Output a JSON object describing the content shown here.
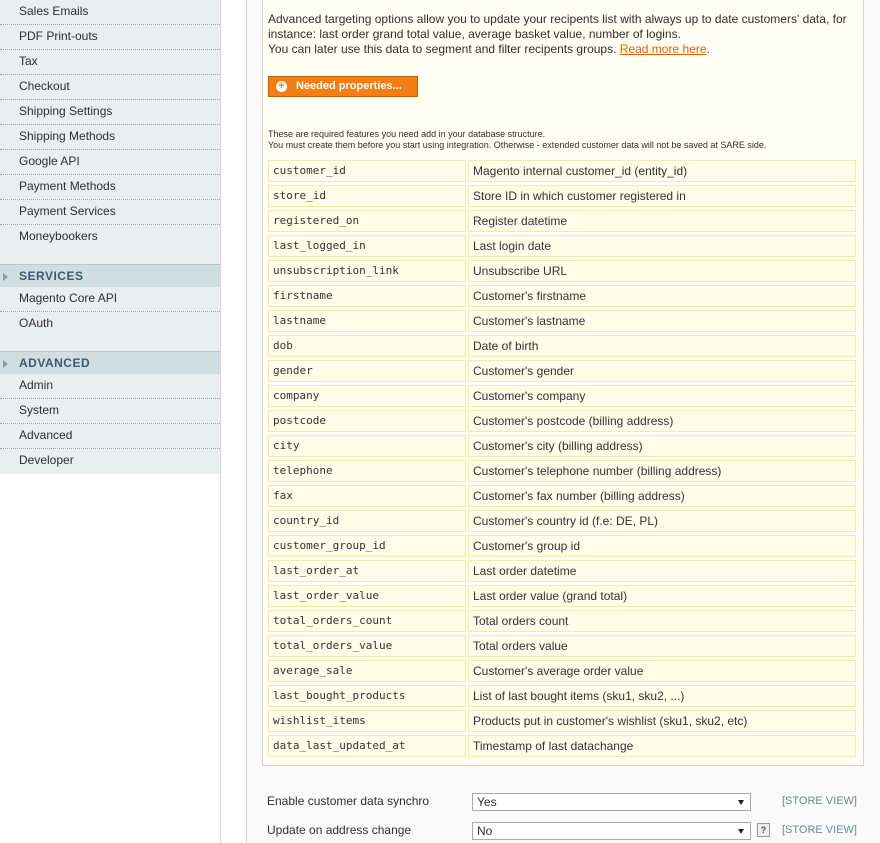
{
  "sidebar": {
    "items_top": [
      "Sales Emails",
      "PDF Print-outs",
      "Tax",
      "Checkout",
      "Shipping Settings",
      "Shipping Methods",
      "Google API",
      "Payment Methods",
      "Payment Services",
      "Moneybookers"
    ],
    "services_header": "SERVICES",
    "services_items": [
      "Magento Core API",
      "OAuth"
    ],
    "advanced_header": "ADVANCED",
    "advanced_items": [
      "Admin",
      "System",
      "Advanced",
      "Developer"
    ]
  },
  "info": {
    "intro_text": "Advanced targeting options allow you to update your recipents list with always up to date customers' data, for instance: last order grand total value, average basket value, number of logins.",
    "intro_text2": "You can later use this data to segment and filter recipents groups.",
    "read_more": "Read more here",
    "needed_button": "Needed properties...",
    "note_line1": "These are required features you need add in your database structure.",
    "note_line2": "You must create them before you start using integration. Otherwise - extended customer data will not be saved at SARE side.",
    "properties": [
      {
        "code": "customer_id",
        "desc": "Magento internal customer_id (entity_id)"
      },
      {
        "code": "store_id",
        "desc": "Store ID in which customer registered in"
      },
      {
        "code": "registered_on",
        "desc": "Register datetime"
      },
      {
        "code": "last_logged_in",
        "desc": "Last login date"
      },
      {
        "code": "unsubscription_link",
        "desc": "Unsubscribe URL"
      },
      {
        "code": "firstname",
        "desc": "Customer's firstname"
      },
      {
        "code": "lastname",
        "desc": "Customer's lastname"
      },
      {
        "code": "dob",
        "desc": "Date of birth"
      },
      {
        "code": "gender",
        "desc": "Customer's gender"
      },
      {
        "code": "company",
        "desc": "Customer's company"
      },
      {
        "code": "postcode",
        "desc": "Customer's postcode (billing address)"
      },
      {
        "code": "city",
        "desc": "Customer's city (billing address)"
      },
      {
        "code": "telephone",
        "desc": "Customer's telephone number (billing address)"
      },
      {
        "code": "fax",
        "desc": "Customer's fax number (billing address)"
      },
      {
        "code": "country_id",
        "desc": "Customer's country id (f.e: DE, PL)"
      },
      {
        "code": "customer_group_id",
        "desc": "Customer's group id"
      },
      {
        "code": "last_order_at",
        "desc": "Last order datetime"
      },
      {
        "code": "last_order_value",
        "desc": "Last order value (grand total)"
      },
      {
        "code": "total_orders_count",
        "desc": "Total orders count"
      },
      {
        "code": "total_orders_value",
        "desc": "Total orders value"
      },
      {
        "code": "average_sale",
        "desc": "Customer's average order value"
      },
      {
        "code": "last_bought_products",
        "desc": "List of last bought items (sku1, sku2, ...)"
      },
      {
        "code": "wishlist_items",
        "desc": "Products put in customer's wishlist (sku1, sku2, etc)"
      },
      {
        "code": "data_last_updated_at",
        "desc": "Timestamp of last datachange"
      }
    ]
  },
  "form": {
    "sync_label": "Enable customer data synchro",
    "sync_value": "Yes",
    "sync_scope": "[STORE VIEW]",
    "address_label": "Update on address change",
    "address_value": "No",
    "address_help": "?",
    "address_scope": "[STORE VIEW]"
  },
  "colors": {
    "accent": "#f47e14",
    "link": "#eb5e00",
    "section_header_text": "#3b5a73",
    "scope_text": "#6f8992"
  }
}
